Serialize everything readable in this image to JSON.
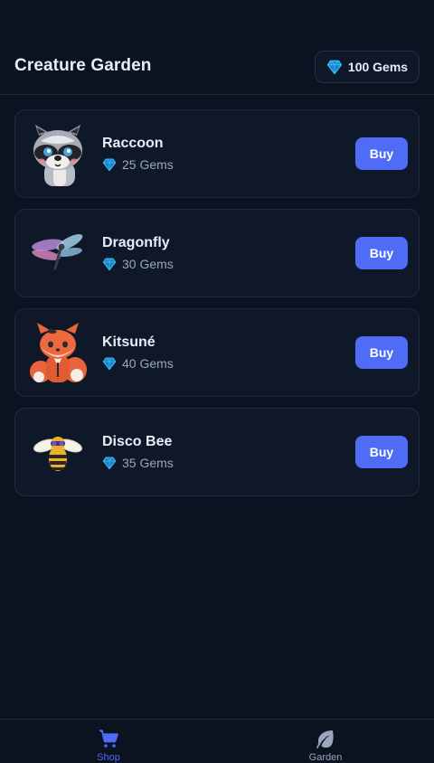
{
  "header": {
    "title": "Creature Garden",
    "gem_balance": "100 Gems",
    "gem_icon": "gem-icon"
  },
  "shop": {
    "items": [
      {
        "name": "Raccoon",
        "price": "25 Gems",
        "buy_label": "Buy",
        "icon": "raccoon-icon"
      },
      {
        "name": "Dragonfly",
        "price": "30 Gems",
        "buy_label": "Buy",
        "icon": "dragonfly-icon"
      },
      {
        "name": "Kitsuné",
        "price": "40 Gems",
        "buy_label": "Buy",
        "icon": "kitsune-icon"
      },
      {
        "name": "Disco Bee",
        "price": "35 Gems",
        "buy_label": "Buy",
        "icon": "disco-bee-icon"
      }
    ]
  },
  "nav": {
    "tabs": [
      {
        "label": "Shop",
        "icon": "cart-icon",
        "active": true
      },
      {
        "label": "Garden",
        "icon": "leaf-icon",
        "active": false
      }
    ]
  },
  "colors": {
    "background": "#0b1220",
    "card": "#0f1829",
    "accent": "#4f6cf7",
    "gem": "#38bdf8",
    "muted_text": "#9aa6bb"
  }
}
